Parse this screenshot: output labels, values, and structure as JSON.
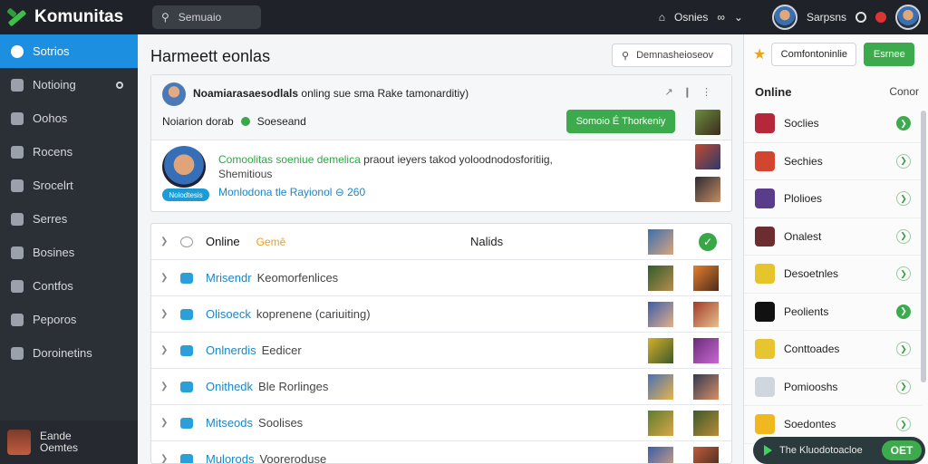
{
  "app": {
    "name": "Komunitas"
  },
  "topbar": {
    "search_text": "Semuaio",
    "links": [
      "Osnies"
    ],
    "user_label": "Sarpsns"
  },
  "sidebar": {
    "items": [
      {
        "label": "Sotrios",
        "active": true
      },
      {
        "label": "Notioing"
      },
      {
        "label": "Oohos"
      },
      {
        "label": "Rocens"
      },
      {
        "label": "Srocelrt"
      },
      {
        "label": "Serres"
      },
      {
        "label": "Bosines"
      },
      {
        "label": "Contfos"
      },
      {
        "label": "Peporos"
      },
      {
        "label": "Doroinetins"
      }
    ],
    "user": {
      "line1": "Eande",
      "line2": "Oemtes"
    }
  },
  "main": {
    "title": "Harmeett eonlas",
    "search_text": "Demnasheioseov",
    "card": {
      "top_text_bold": "Noamiarasaesodlals",
      "top_text_rest": " onling  sue sma Rake tamonarditiy)",
      "actions": "↗ ❙ ⋮",
      "sub_text": "Noiarion dorab",
      "sub_status": "Soeseand",
      "button": "Somoio É Thorkeniy",
      "line1_green": "Comoolitas soeniue demelica",
      "line1_rest": " praout  ieyers takod  yoloodnodosforitiig,",
      "line2": "Shemitious",
      "line3": "Monlodona tle Rayionol ⊖ 260",
      "tag": "Nolodtesis"
    },
    "list": {
      "header": {
        "label": "Online",
        "ghost": "Gemê",
        "col": "Nalids"
      },
      "rows": [
        {
          "label": "Mrisendr",
          "detail": "Keomorfenlices"
        },
        {
          "label": "Olisoeck",
          "detail": "koprenene (cariuiting)"
        },
        {
          "label": "Onlnerdis",
          "detail": "Eedicer"
        },
        {
          "label": "Onithedk",
          "detail": "Ble Rorlinges"
        },
        {
          "label": "Mitseods",
          "detail": "Soolises"
        },
        {
          "label": "Mulorods",
          "detail": "Vooreroduse"
        }
      ]
    }
  },
  "right": {
    "button": "Comfontoninlie",
    "green_button": "Esrnee",
    "online_label": "Online",
    "online_sub": "Conor",
    "items": [
      {
        "label": "Soclies",
        "color": "#b5283a",
        "on": true
      },
      {
        "label": "Sechies",
        "color": "#d2452e",
        "on": false
      },
      {
        "label": "Plolioes",
        "color": "#5a3d8a",
        "on": false
      },
      {
        "label": "Onalest",
        "color": "#6b2d2f",
        "on": false
      },
      {
        "label": "Desoetnles",
        "color": "#e6c42c",
        "on": false
      },
      {
        "label": "Peolients",
        "color": "#111111",
        "on": true
      },
      {
        "label": "Conttoades",
        "color": "#e7c531",
        "on": false
      },
      {
        "label": "Pomiooshs",
        "color": "#cfd6de",
        "on": false
      },
      {
        "label": "Soedontes",
        "color": "#f0b81e",
        "on": false
      }
    ],
    "chat": {
      "label": "The Kluodotoacloe",
      "button": "OET"
    }
  }
}
